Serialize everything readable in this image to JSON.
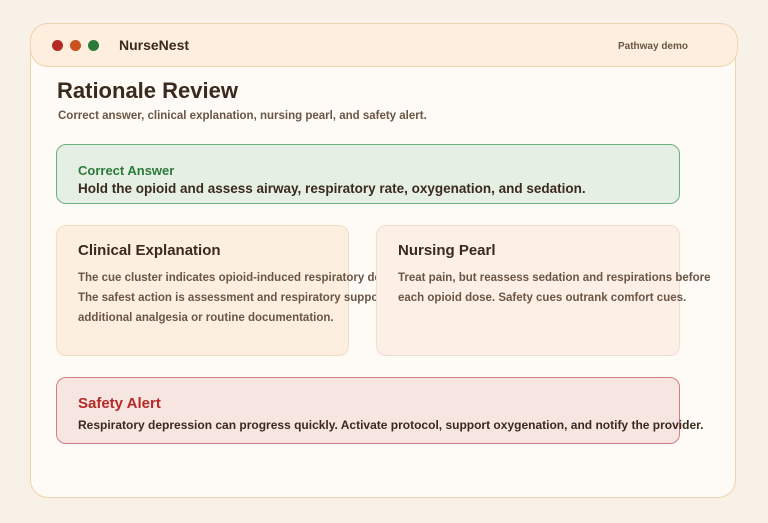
{
  "window": {
    "app_title": "NurseNest",
    "mode_label": "Pathway demo",
    "controls": [
      "close-dot",
      "minimize-dot",
      "maximize-dot"
    ]
  },
  "page": {
    "title": "Rationale Review",
    "subtitle": "Correct answer, clinical explanation, nursing pearl, and safety alert."
  },
  "correct_answer": {
    "label": "Correct Answer",
    "text": "Hold the opioid and assess airway, respiratory rate, oxygenation, and sedation."
  },
  "clinical_explanation": {
    "heading": "Clinical Explanation",
    "lines": [
      "The cue cluster indicates opioid-induced respiratory depression.",
      "The safest action is assessment and respiratory support before",
      "additional analgesia or routine documentation."
    ]
  },
  "nursing_pearl": {
    "heading": "Nursing Pearl",
    "lines": [
      "Treat pain, but reassess sedation and respirations before",
      "each opioid dose. Safety cues outrank comfort cues."
    ]
  },
  "safety_alert": {
    "label": "Safety Alert",
    "text": "Respiratory depression can progress quickly. Activate protocol, support oxygenation, and notify the provider."
  },
  "colors": {
    "accent_green": "#2b7a3b",
    "accent_red": "#b52a25",
    "text_dark": "#3a2a1e",
    "text_muted": "#6b5645"
  }
}
